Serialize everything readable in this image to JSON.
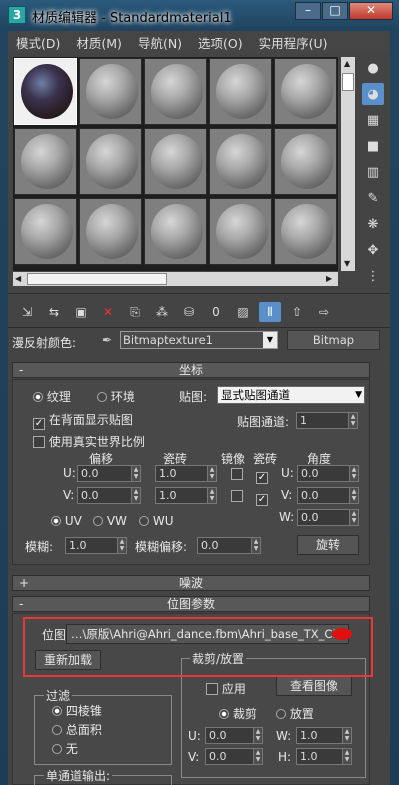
{
  "window": {
    "title": "材质编辑器 - Standardmaterial1",
    "app_icon": "3"
  },
  "menu": [
    "模式(D)",
    "材质(M)",
    "导航(N)",
    "选项(O)",
    "实用程序(U)"
  ],
  "side_tools": [
    "sample-type-icon",
    "backlight-icon",
    "background-icon",
    "sample-uv-icon",
    "video-color-icon",
    "make-preview-icon",
    "options-icon",
    "select-by-material-icon",
    "material-navigator-icon"
  ],
  "map_row": {
    "label": "漫反射颜色:",
    "material_name": "Bitmaptexture1",
    "type_button": "Bitmap"
  },
  "coords": {
    "header": "坐标",
    "sign": "-",
    "radio_texture": "纹理",
    "radio_env": "环境",
    "mapping_label": "贴图:",
    "mapping_value": "显式贴图通道",
    "show_back": "在背面显示贴图",
    "map_channel_label": "贴图通道:",
    "map_channel_value": "1",
    "real_world": "使用真实世界比例",
    "col_offset": "偏移",
    "col_tiling": "瓷砖",
    "col_mirror": "镜像",
    "col_tile": "瓷砖",
    "col_angle": "角度",
    "u_label": "U:",
    "v_label": "V:",
    "w_label": "W:",
    "u_offset": "0.0",
    "v_offset": "0.0",
    "u_tiling": "1.0",
    "v_tiling": "1.0",
    "u_angle": "0.0",
    "v_angle": "0.0",
    "w_angle": "0.0",
    "check_mark": "✓",
    "uv": "UV",
    "vw": "VW",
    "wu": "WU",
    "blur_label": "模糊:",
    "blur_value": "1.0",
    "blur_offset_label": "模糊偏移:",
    "blur_offset_value": "0.0",
    "rotate_button": "旋转"
  },
  "noise": {
    "header": "噪波",
    "sign": "+"
  },
  "bitmap_params": {
    "header": "位图参数",
    "sign": "-",
    "bitmap_label": "位图:",
    "bitmap_path": "…\\原版\\Ahri@Ahri_dance.fbm\\Ahri_base_TX_CM.",
    "reload_button": "重新加载",
    "crop_group": "裁剪/放置",
    "apply_label": "应用",
    "view_image_button": "查看图像",
    "crop_radio": "裁剪",
    "place_radio": "放置",
    "u_label": "U:",
    "v_label": "V:",
    "w_label": "W:",
    "h_label": "H:",
    "u_value": "0.0",
    "v_value": "0.0",
    "w_value": "1.0",
    "h_value": "1.0",
    "filter_group": "过滤",
    "filter_pyramidal": "四棱锥",
    "filter_sat": "总面积",
    "filter_none": "无",
    "mono_output": "单通道输出:"
  },
  "colors": {
    "highlight": "#e53935",
    "active_tool": "#5a90c9"
  }
}
